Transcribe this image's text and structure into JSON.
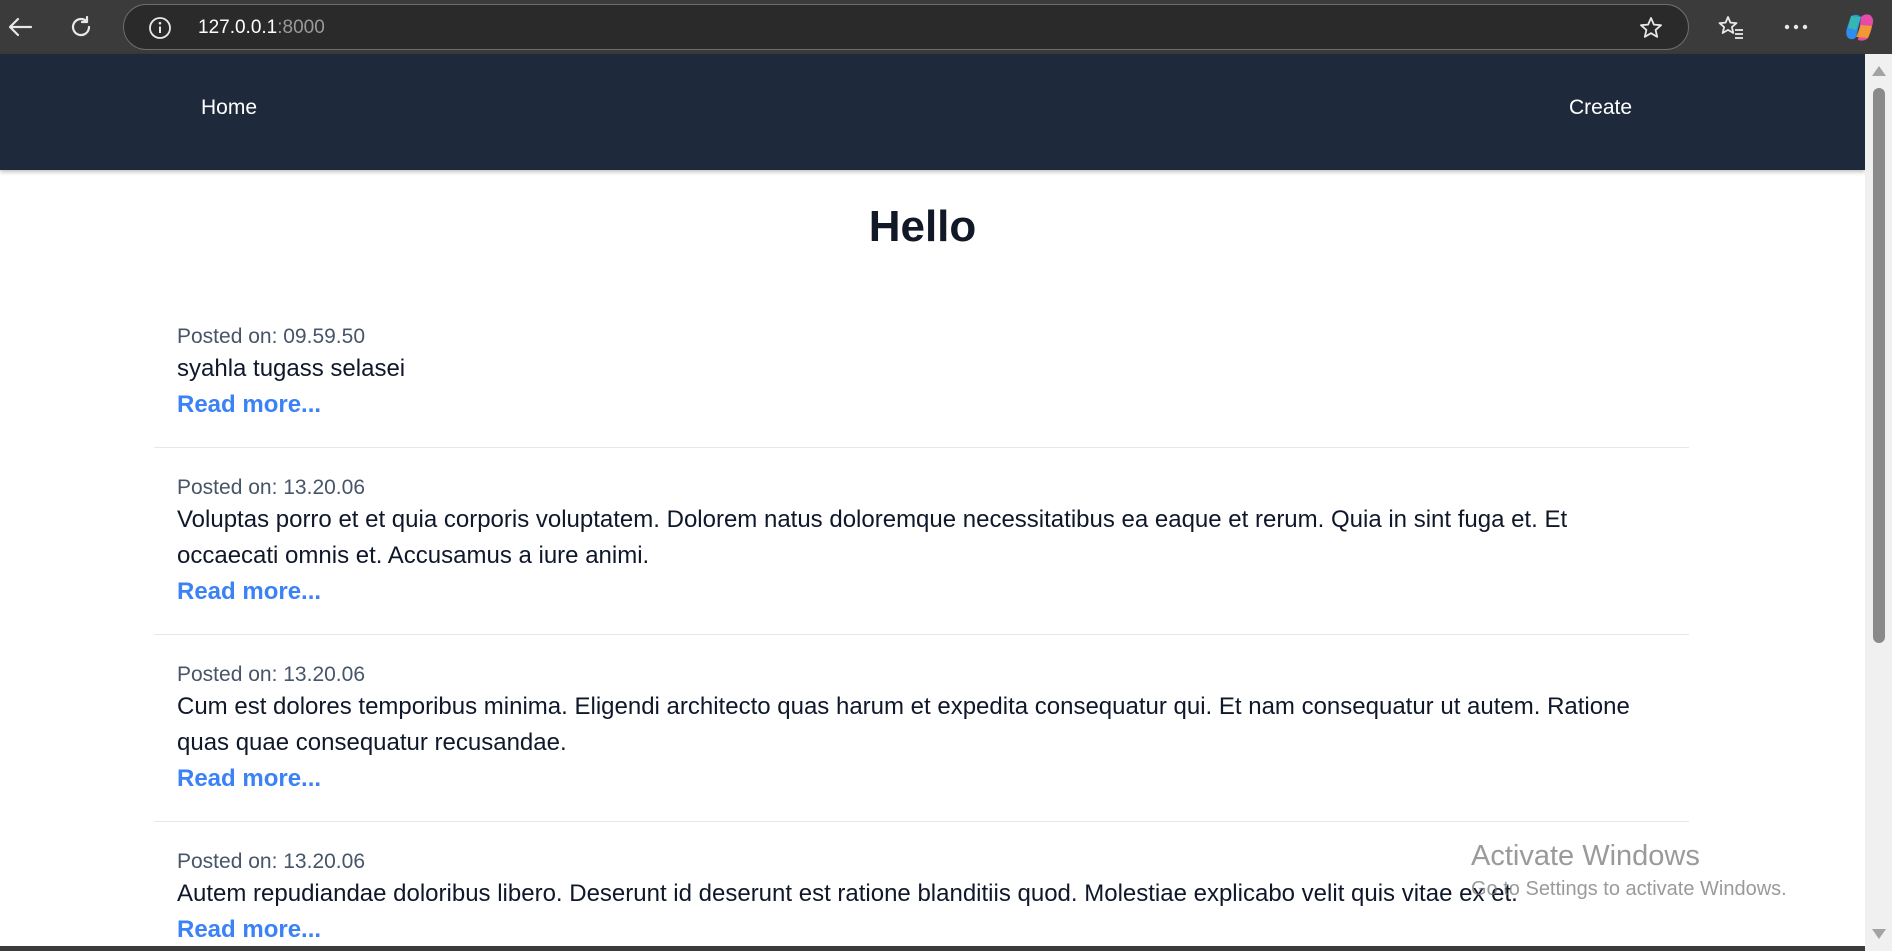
{
  "browser": {
    "url_host": "127.0.0.1",
    "url_port": ":8000",
    "icons": [
      "back-icon",
      "reload-icon",
      "info-icon",
      "star-icon",
      "favorites-icon",
      "more-icon",
      "copilot-icon"
    ]
  },
  "nav": {
    "home_label": "Home",
    "create_label": "Create"
  },
  "page": {
    "title": "Hello"
  },
  "posts": [
    {
      "date_prefix": "Posted on: ",
      "date": "09.59.50",
      "body": "syahla tugass selasei",
      "read_more": "Read more..."
    },
    {
      "date_prefix": "Posted on: ",
      "date": "13.20.06",
      "body": "Voluptas porro et et quia corporis voluptatem. Dolorem natus doloremque necessitatibus ea eaque et rerum. Quia in sint fuga et. Et occaecati omnis et. Accusamus a iure animi.",
      "read_more": "Read more..."
    },
    {
      "date_prefix": "Posted on: ",
      "date": "13.20.06",
      "body": "Cum est dolores temporibus minima. Eligendi architecto quas harum et expedita consequatur qui. Et nam consequatur ut autem. Ratione quas quae consequatur recusandae.",
      "read_more": "Read more..."
    },
    {
      "date_prefix": "Posted on: ",
      "date": "13.20.06",
      "body": "Autem repudiandae doloribus libero. Deserunt id deserunt est ratione blanditiis quod. Molestiae explicabo velit quis vitae ex et.",
      "read_more": "Read more..."
    }
  ],
  "watermark": {
    "title": "Activate Windows",
    "subtitle": "Go to Settings to activate Windows."
  },
  "colors": {
    "navbar": "#1e293b",
    "link": "#3b82f6",
    "title": "#111827"
  }
}
